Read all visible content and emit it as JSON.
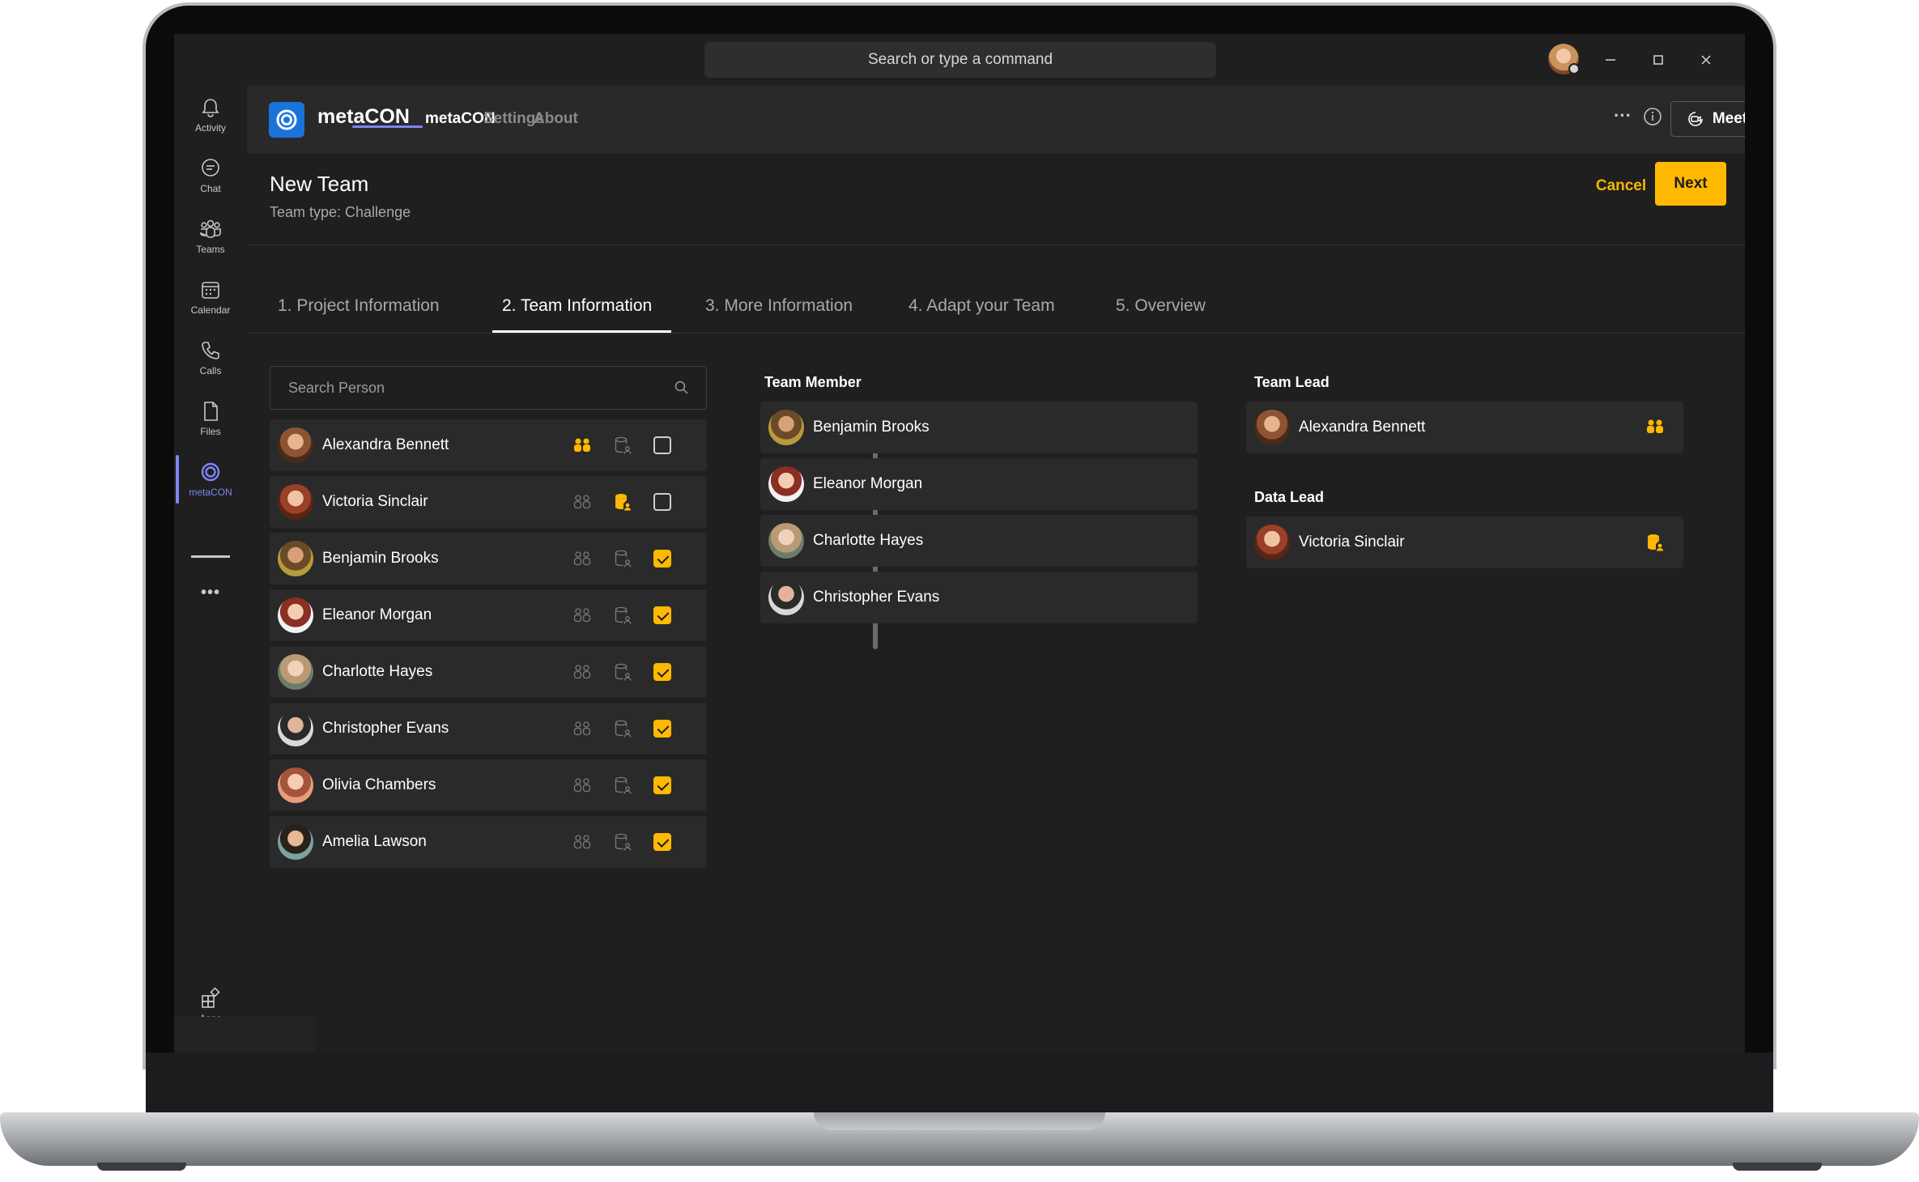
{
  "titlebar": {
    "search_text": "Search or type a command"
  },
  "rail": {
    "items": [
      {
        "label": "Activity",
        "icon": "bell-icon"
      },
      {
        "label": "Chat",
        "icon": "chat-icon"
      },
      {
        "label": "Teams",
        "icon": "teams-icon"
      },
      {
        "label": "Calendar",
        "icon": "calendar-icon"
      },
      {
        "label": "Calls",
        "icon": "phone-icon"
      },
      {
        "label": "Files",
        "icon": "file-icon"
      },
      {
        "label": "metaCON",
        "icon": "metacon-icon"
      }
    ],
    "more_label": "•••",
    "apps_label": "Apps"
  },
  "app_header": {
    "app_name": "metaCON",
    "tabs": [
      "metaCON",
      "Settings",
      "About"
    ],
    "active_tab": "metaCON",
    "more_label": "···",
    "meet_label": "Meet"
  },
  "page": {
    "title": "New Team",
    "subtitle": "Team type: Challenge",
    "cancel_label": "Cancel",
    "next_label": "Next"
  },
  "steps": [
    "1.  Project Information",
    "2. Team Information",
    "3. More Information",
    "4. Adapt your Team",
    "5. Overview"
  ],
  "active_step": 1,
  "search": {
    "placeholder": "Search Person",
    "value": ""
  },
  "people": [
    {
      "name": "Alexandra Bennett",
      "team_lead": true,
      "data_lead": false,
      "checked": false
    },
    {
      "name": "Victoria Sinclair",
      "team_lead": false,
      "data_lead": true,
      "checked": false
    },
    {
      "name": "Benjamin Brooks",
      "team_lead": false,
      "data_lead": false,
      "checked": true
    },
    {
      "name": "Eleanor Morgan",
      "team_lead": false,
      "data_lead": false,
      "checked": true
    },
    {
      "name": "Charlotte Hayes",
      "team_lead": false,
      "data_lead": false,
      "checked": true
    },
    {
      "name": "Christopher Evans",
      "team_lead": false,
      "data_lead": false,
      "checked": true
    },
    {
      "name": "Olivia Chambers",
      "team_lead": false,
      "data_lead": false,
      "checked": true
    },
    {
      "name": "Amelia Lawson",
      "team_lead": false,
      "data_lead": false,
      "checked": true
    }
  ],
  "team_member": {
    "title": "Team Member",
    "members": [
      "Benjamin Brooks",
      "Eleanor Morgan",
      "Charlotte Hayes",
      "Christopher Evans"
    ]
  },
  "team_lead": {
    "title": "Team Lead",
    "name": "Alexandra Bennett"
  },
  "data_lead": {
    "title": "Data Lead",
    "name": "Victoria Sinclair"
  },
  "colors": {
    "accent": "#ffb900",
    "teams_purple": "#7f85f5",
    "app_blue": "#1a73d9",
    "row_bg": "#2a2a2a",
    "bg": "#1f1f1f"
  }
}
